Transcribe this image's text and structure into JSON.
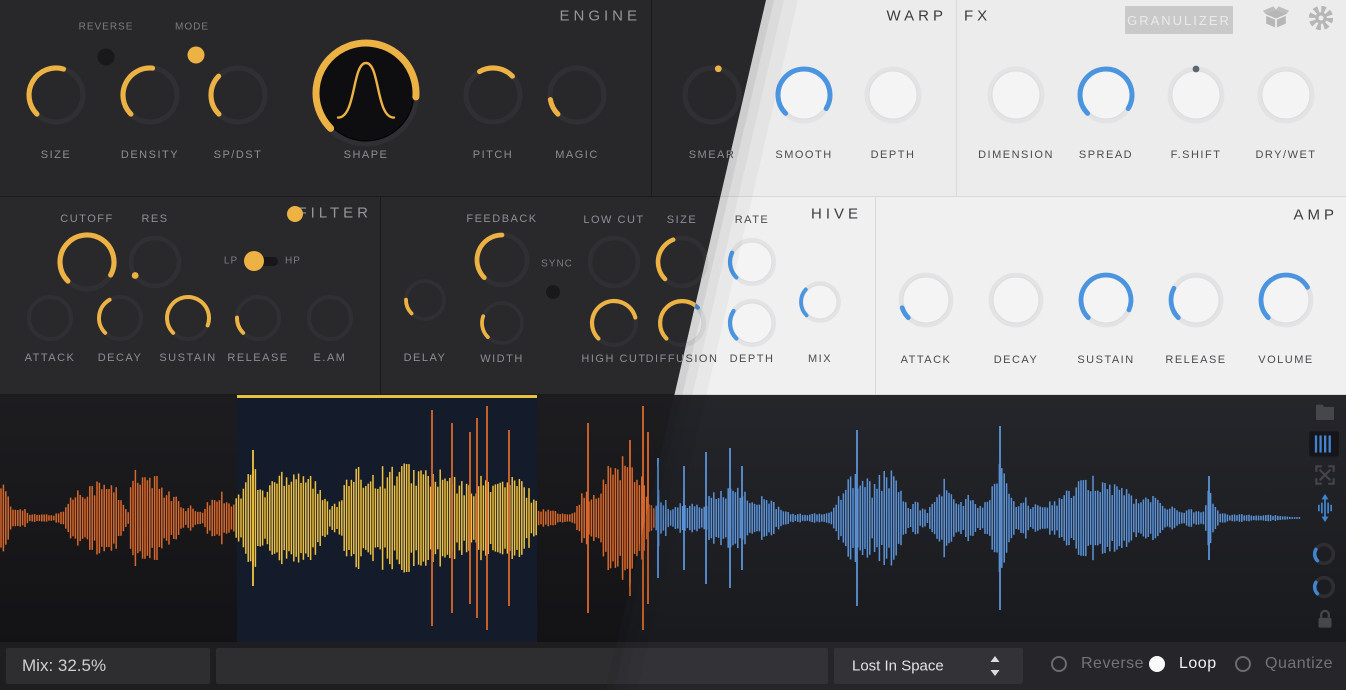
{
  "theme": {
    "dark_accent": "#edb244",
    "light_accent": "#4a94e0",
    "waveform_orange": "#d9682c",
    "waveform_yellow": "#efc13f",
    "waveform_blue": "#5b93d8",
    "selection_bar": "#e9c13f"
  },
  "sections": {
    "engine": {
      "title": "ENGINE",
      "reverse": {
        "label": "REVERSE",
        "on": false
      },
      "mode": {
        "label": "MODE",
        "on": true
      },
      "knobs": {
        "size": {
          "label": "SIZE",
          "value": 0.56
        },
        "density": {
          "label": "DENSITY",
          "value": 0.52
        },
        "spdst": {
          "label": "SP/DST",
          "value": 0.33
        },
        "shape": {
          "label": "SHAPE",
          "value": 0.85
        },
        "pitch": {
          "label": "PITCH",
          "start": 0.39,
          "value": 0.67
        },
        "magic": {
          "label": "MAGIC",
          "value": 0.13
        }
      }
    },
    "warp": {
      "title": "WARP",
      "knobs": {
        "smear": {
          "label": "SMEAR",
          "dot": 0.55
        },
        "smooth": {
          "label": "SMOOTH",
          "value": 0.95
        },
        "depth": {
          "label": "DEPTH",
          "value": 0
        }
      }
    },
    "fx": {
      "title": "FX",
      "button_label": "GRANULIZER",
      "knobs": {
        "dimension": {
          "label": "DIMENSION",
          "value": 0
        },
        "spread": {
          "label": "SPREAD",
          "value": 0.95
        },
        "fshift": {
          "label": "F.SHIFT",
          "dot": 0.5,
          "dotDim": true
        },
        "drywet": {
          "label": "DRY/WET",
          "value": 0
        }
      }
    },
    "filter": {
      "title": "FILTER",
      "enabled": true,
      "lp_label": "LP",
      "hp_label": "HP",
      "mode": "LP",
      "knobs": {
        "cutoff": {
          "label": "CUTOFF",
          "value": 0.94,
          "labelAbove": true
        },
        "res": {
          "label": "RES",
          "dot": 0.04,
          "labelAbove": true
        },
        "attack": {
          "label": "ATTACK",
          "value": 0
        },
        "decay": {
          "label": "DECAY",
          "value": 0.39
        },
        "sustain": {
          "label": "SUSTAIN",
          "value": 0.91
        },
        "release": {
          "label": "RELEASE",
          "value": 0.17
        },
        "eam": {
          "label": "E.AM",
          "value": 0
        }
      }
    },
    "delay": {
      "sync": {
        "label": "SYNC",
        "on": false
      },
      "knobs": {
        "delay": {
          "label": "DELAY",
          "value": 0.17
        },
        "feedback": {
          "label": "FEEDBACK",
          "value": 0.5,
          "labelAbove": true
        },
        "width": {
          "label": "WIDTH",
          "value": 0.24
        },
        "lowcut": {
          "label": "LOW CUT",
          "value": 0,
          "labelAbove": true
        },
        "highcut": {
          "label": "HIGH CUT",
          "value": 0.78
        },
        "size": {
          "label": "SIZE",
          "value": 0.42,
          "labelAbove": true
        },
        "diffusion": {
          "label": "DIFFUSION",
          "value": 0.67
        }
      }
    },
    "hive": {
      "title": "HIVE",
      "knobs": {
        "rate": {
          "label": "RATE",
          "value": 0.26,
          "labelAbove": true
        },
        "depth": {
          "label": "DEPTH",
          "value": 0.29
        },
        "mix": {
          "label": "MIX",
          "value": 0.32
        }
      }
    },
    "amp": {
      "title": "AMP",
      "knobs": {
        "attack": {
          "label": "ATTACK",
          "value": 0.1
        },
        "decay": {
          "label": "DECAY",
          "value": 0
        },
        "sustain": {
          "label": "SUSTAIN",
          "value": 0.92
        },
        "release": {
          "label": "RELEASE",
          "value": 0.27
        },
        "volume": {
          "label": "VOLUME",
          "value": 0.72
        }
      }
    }
  },
  "waveform": {
    "selection": {
      "start": 237,
      "end": 537
    },
    "regions": [
      [
        236,
        "#d9682c"
      ],
      [
        537,
        "#efc13f"
      ],
      [
        654,
        "#d9682c"
      ],
      [
        1346,
        "#5b93d8"
      ]
    ],
    "envelope": [
      [
        0,
        45
      ],
      [
        6,
        30
      ],
      [
        12,
        10
      ],
      [
        22,
        14
      ],
      [
        30,
        4
      ],
      [
        55,
        4
      ],
      [
        62,
        8
      ],
      [
        75,
        30
      ],
      [
        95,
        40
      ],
      [
        115,
        36
      ],
      [
        128,
        8
      ],
      [
        133,
        55
      ],
      [
        140,
        42
      ],
      [
        150,
        48
      ],
      [
        162,
        38
      ],
      [
        175,
        25
      ],
      [
        185,
        8
      ],
      [
        192,
        14
      ],
      [
        200,
        6
      ],
      [
        212,
        22
      ],
      [
        222,
        28
      ],
      [
        232,
        18
      ],
      [
        238,
        25
      ],
      [
        245,
        40
      ],
      [
        253,
        66
      ],
      [
        258,
        38
      ],
      [
        264,
        30
      ],
      [
        272,
        45
      ],
      [
        285,
        55
      ],
      [
        300,
        58
      ],
      [
        312,
        48
      ],
      [
        322,
        25
      ],
      [
        330,
        15
      ],
      [
        338,
        20
      ],
      [
        348,
        45
      ],
      [
        360,
        52
      ],
      [
        375,
        50
      ],
      [
        390,
        55
      ],
      [
        405,
        58
      ],
      [
        420,
        55
      ],
      [
        432,
        50
      ],
      [
        445,
        48
      ],
      [
        458,
        40
      ],
      [
        468,
        35
      ],
      [
        478,
        42
      ],
      [
        490,
        45
      ],
      [
        500,
        40
      ],
      [
        510,
        45
      ],
      [
        520,
        42
      ],
      [
        530,
        30
      ],
      [
        536,
        20
      ],
      [
        540,
        8
      ],
      [
        548,
        12
      ],
      [
        558,
        6
      ],
      [
        566,
        4
      ],
      [
        575,
        10
      ],
      [
        580,
        25
      ],
      [
        588,
        30
      ],
      [
        595,
        22
      ],
      [
        600,
        30
      ],
      [
        608,
        55
      ],
      [
        615,
        65
      ],
      [
        622,
        68
      ],
      [
        630,
        60
      ],
      [
        638,
        55
      ],
      [
        645,
        40
      ],
      [
        650,
        20
      ],
      [
        655,
        8
      ],
      [
        658,
        35
      ],
      [
        662,
        10
      ],
      [
        666,
        25
      ],
      [
        670,
        8
      ],
      [
        676,
        12
      ],
      [
        682,
        18
      ],
      [
        688,
        12
      ],
      [
        694,
        18
      ],
      [
        700,
        10
      ],
      [
        707,
        20
      ],
      [
        712,
        38
      ],
      [
        718,
        25
      ],
      [
        724,
        30
      ],
      [
        730,
        38
      ],
      [
        736,
        30
      ],
      [
        742,
        32
      ],
      [
        748,
        25
      ],
      [
        754,
        15
      ],
      [
        760,
        22
      ],
      [
        766,
        25
      ],
      [
        772,
        18
      ],
      [
        778,
        12
      ],
      [
        785,
        8
      ],
      [
        795,
        5
      ],
      [
        805,
        4
      ],
      [
        815,
        5
      ],
      [
        825,
        4
      ],
      [
        835,
        15
      ],
      [
        842,
        35
      ],
      [
        850,
        48
      ],
      [
        858,
        50
      ],
      [
        866,
        42
      ],
      [
        872,
        35
      ],
      [
        876,
        45
      ],
      [
        884,
        50
      ],
      [
        892,
        48
      ],
      [
        900,
        38
      ],
      [
        905,
        20
      ],
      [
        910,
        10
      ],
      [
        916,
        18
      ],
      [
        922,
        12
      ],
      [
        928,
        8
      ],
      [
        934,
        25
      ],
      [
        940,
        35
      ],
      [
        946,
        42
      ],
      [
        952,
        30
      ],
      [
        958,
        15
      ],
      [
        964,
        20
      ],
      [
        970,
        25
      ],
      [
        976,
        18
      ],
      [
        982,
        12
      ],
      [
        988,
        20
      ],
      [
        994,
        45
      ],
      [
        1000,
        60
      ],
      [
        1006,
        50
      ],
      [
        1012,
        20
      ],
      [
        1018,
        12
      ],
      [
        1025,
        22
      ],
      [
        1032,
        15
      ],
      [
        1040,
        12
      ],
      [
        1048,
        18
      ],
      [
        1055,
        20
      ],
      [
        1062,
        25
      ],
      [
        1068,
        30
      ],
      [
        1075,
        35
      ],
      [
        1082,
        40
      ],
      [
        1090,
        42
      ],
      [
        1098,
        45
      ],
      [
        1106,
        42
      ],
      [
        1114,
        38
      ],
      [
        1122,
        35
      ],
      [
        1130,
        28
      ],
      [
        1138,
        20
      ],
      [
        1145,
        22
      ],
      [
        1152,
        25
      ],
      [
        1160,
        20
      ],
      [
        1168,
        15
      ],
      [
        1175,
        10
      ],
      [
        1182,
        8
      ],
      [
        1190,
        10
      ],
      [
        1198,
        8
      ],
      [
        1205,
        12
      ],
      [
        1209,
        35
      ],
      [
        1213,
        15
      ],
      [
        1220,
        6
      ],
      [
        1230,
        4
      ],
      [
        1240,
        5
      ],
      [
        1250,
        4
      ],
      [
        1258,
        3
      ],
      [
        1266,
        4
      ],
      [
        1275,
        3
      ],
      [
        1285,
        2
      ],
      [
        1295,
        1
      ],
      [
        1346,
        1
      ]
    ],
    "spikes": [
      [
        253,
        68,
        "y"
      ],
      [
        432,
        108,
        "o"
      ],
      [
        452,
        95,
        "o"
      ],
      [
        470,
        86,
        "o"
      ],
      [
        477,
        100,
        "o"
      ],
      [
        487,
        112,
        "o"
      ],
      [
        509,
        88,
        "o"
      ],
      [
        588,
        95,
        "o"
      ],
      [
        630,
        78,
        "o"
      ],
      [
        643,
        112,
        "o"
      ],
      [
        648,
        86,
        "o"
      ],
      [
        658,
        60,
        "b"
      ],
      [
        684,
        52,
        "b"
      ],
      [
        706,
        66,
        "b"
      ],
      [
        730,
        70,
        "b"
      ],
      [
        742,
        52,
        "b"
      ],
      [
        857,
        88,
        "b"
      ],
      [
        1000,
        92,
        "b"
      ],
      [
        1209,
        42,
        "b"
      ]
    ],
    "spike_colors": {
      "o": "#d9682c",
      "y": "#f0c341",
      "b": "#5b93d8"
    }
  },
  "toolbar_icons": [
    "folder",
    "grains",
    "expand",
    "stretch",
    "loop-a",
    "loop-b",
    "lock"
  ],
  "footer": {
    "mix": "Mix: 32.5%",
    "preset": "Lost In Space",
    "radios": [
      {
        "label": "Reverse",
        "selected": false
      },
      {
        "label": "Loop",
        "selected": true
      },
      {
        "label": "Quantize",
        "selected": false
      }
    ]
  }
}
